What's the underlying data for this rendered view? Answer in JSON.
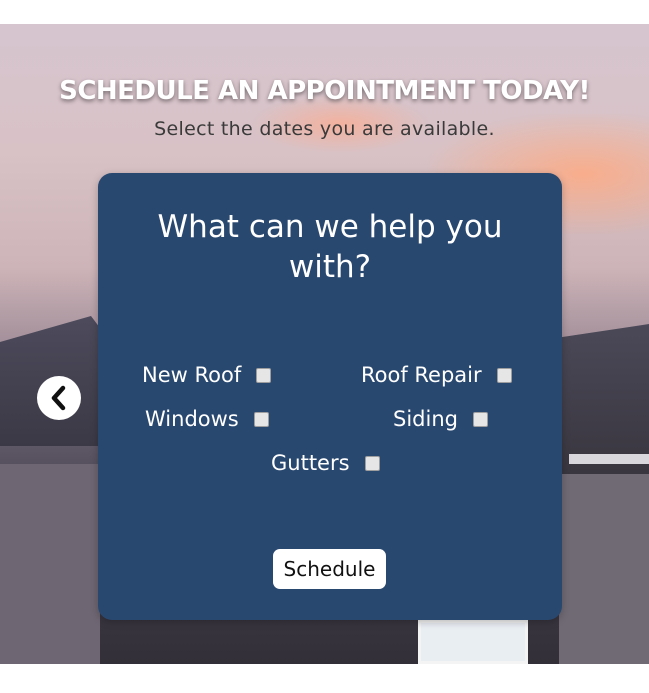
{
  "hero": {
    "heading": "SCHEDULE AN APPOINTMENT TODAY!",
    "subheading": "Select the dates you are available."
  },
  "carousel": {
    "prev_icon": "chevron-left-icon"
  },
  "card": {
    "title": "What can we help you with?",
    "options": {
      "new_roof": "New Roof",
      "roof_repair": "Roof Repair",
      "windows": "Windows",
      "siding": "Siding",
      "gutters": "Gutters"
    },
    "schedule_label": "Schedule"
  },
  "colors": {
    "card_background": "#294870",
    "button_background": "#ffffff",
    "heading_text": "#ffffff"
  }
}
